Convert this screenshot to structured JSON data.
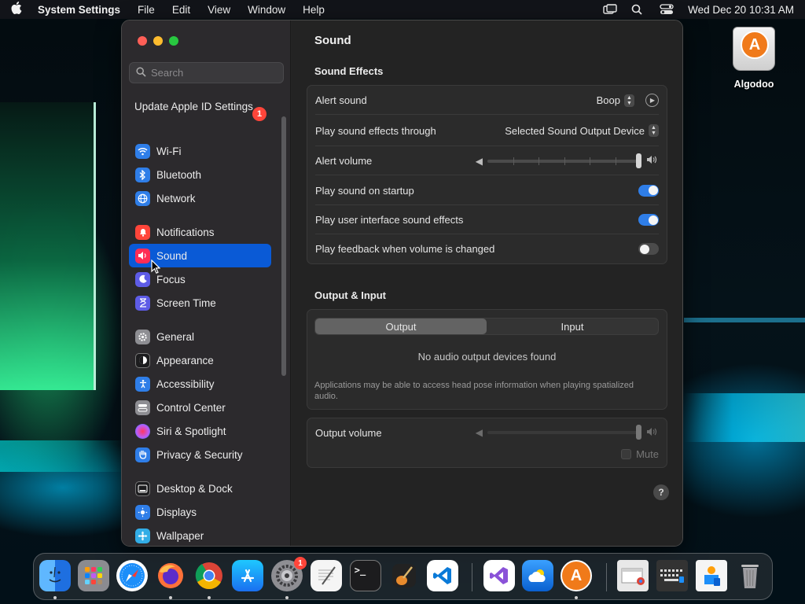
{
  "menubar": {
    "app_name": "System Settings",
    "menus": [
      "File",
      "Edit",
      "View",
      "Window",
      "Help"
    ],
    "clock": "Wed Dec 20  10:31 AM"
  },
  "desktop": {
    "icon_label": "Algodoo"
  },
  "sidebar": {
    "search_placeholder": "Search",
    "apple_id": "Update Apple ID Settings",
    "apple_id_badge": "1",
    "items": [
      {
        "label": "Wi-Fi",
        "icon": "wifi-icon",
        "color": "#2f7ee8"
      },
      {
        "label": "Bluetooth",
        "icon": "bluetooth-icon",
        "color": "#2f7ee8"
      },
      {
        "label": "Network",
        "icon": "globe-icon",
        "color": "#2f7ee8"
      },
      {
        "label": "Notifications",
        "icon": "bell-icon",
        "color": "#ff453a"
      },
      {
        "label": "Sound",
        "icon": "speaker-icon",
        "color": "#ff2d55"
      },
      {
        "label": "Focus",
        "icon": "moon-icon",
        "color": "#5e5ce6"
      },
      {
        "label": "Screen Time",
        "icon": "hourglass-icon",
        "color": "#5e5ce6"
      },
      {
        "label": "General",
        "icon": "gear-icon",
        "color": "#8e8e93"
      },
      {
        "label": "Appearance",
        "icon": "appearance-icon",
        "color": "#1c1c1e"
      },
      {
        "label": "Accessibility",
        "icon": "accessibility-icon",
        "color": "#2f7ee8"
      },
      {
        "label": "Control Center",
        "icon": "control-center-icon",
        "color": "#8e8e93"
      },
      {
        "label": "Siri & Spotlight",
        "icon": "siri-icon",
        "color": "#bf5af2"
      },
      {
        "label": "Privacy & Security",
        "icon": "hand-icon",
        "color": "#2f7ee8"
      },
      {
        "label": "Desktop & Dock",
        "icon": "dock-icon",
        "color": "#1c1c1e"
      },
      {
        "label": "Displays",
        "icon": "sun-icon",
        "color": "#2f7ee8"
      },
      {
        "label": "Wallpaper",
        "icon": "wallpaper-icon",
        "color": "#32ade6"
      }
    ]
  },
  "content": {
    "title": "Sound",
    "sound_effects": {
      "heading": "Sound Effects",
      "alert_sound_label": "Alert sound",
      "alert_sound_value": "Boop",
      "output_through_label": "Play sound effects through",
      "output_through_value": "Selected Sound Output Device",
      "alert_volume_label": "Alert volume",
      "alert_volume_level": 1.0,
      "startup_label": "Play sound on startup",
      "startup_on": true,
      "ui_sounds_label": "Play user interface sound effects",
      "ui_sounds_on": true,
      "feedback_label": "Play feedback when volume is changed",
      "feedback_on": false
    },
    "output_input": {
      "heading": "Output & Input",
      "tab_output": "Output",
      "tab_input": "Input",
      "empty_message": "No audio output devices found",
      "note": "Applications may be able to access head pose information when playing spatialized audio."
    },
    "output_volume": {
      "label": "Output volume",
      "level": 1.0,
      "mute_label": "Mute"
    },
    "help": "?"
  },
  "dock": {
    "settings_badge": "1"
  }
}
